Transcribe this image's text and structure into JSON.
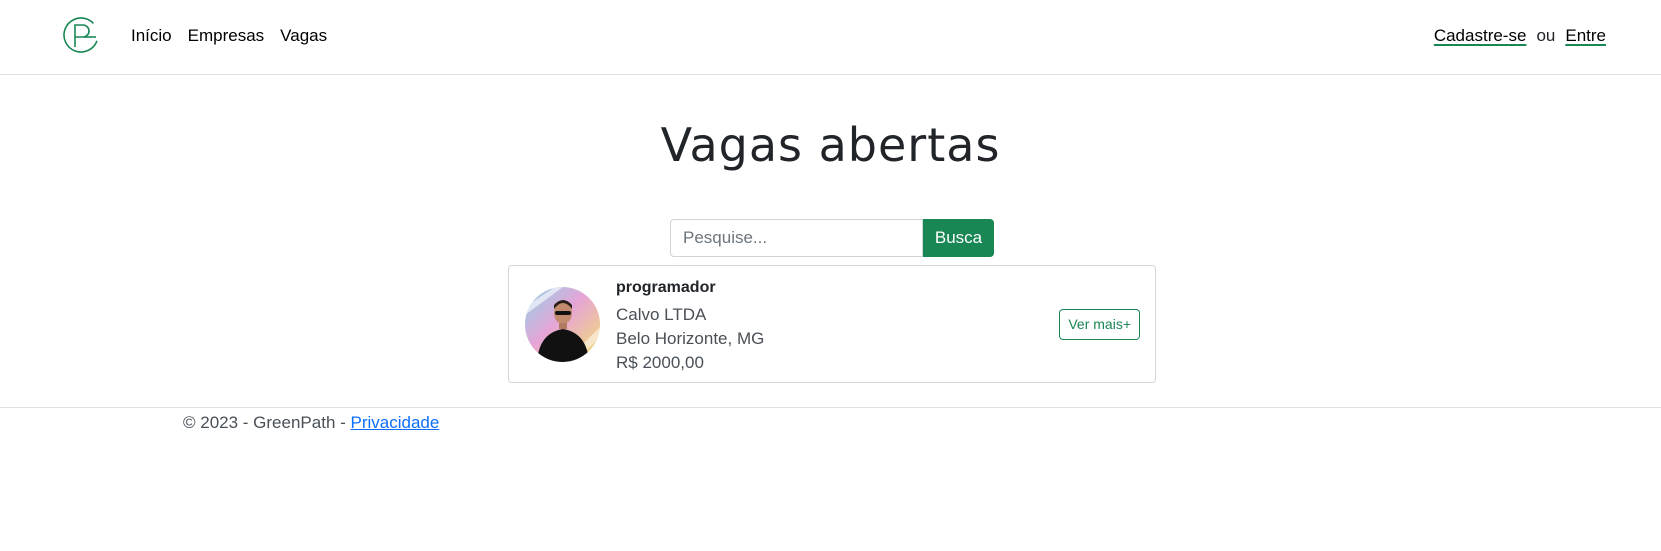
{
  "nav": {
    "logo": "logo-icon",
    "links": [
      "Início",
      "Empresas",
      "Vagas"
    ],
    "signup": "Cadastre-se",
    "or": "ou",
    "login": "Entre"
  },
  "page": {
    "title": "Vagas abertas"
  },
  "search": {
    "placeholder": "Pesquise...",
    "button": "Busca"
  },
  "jobs": [
    {
      "title": "programador",
      "company": "Calvo LTDA",
      "location": "Belo Horizonte, MG",
      "salary": "R$ 2000,00",
      "button": "Ver mais+"
    }
  ],
  "footer": {
    "text": "© 2023 - GreenPath - ",
    "privacy": "Privacidade"
  },
  "colors": {
    "brand": "#198754",
    "link": "#0d6efd"
  }
}
